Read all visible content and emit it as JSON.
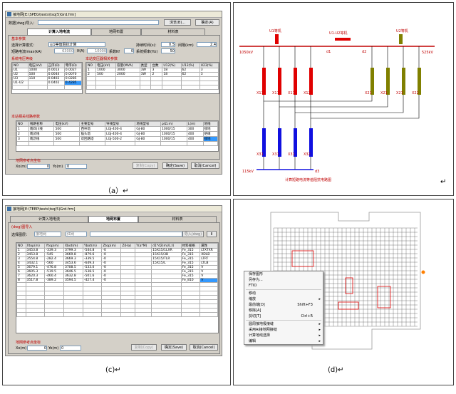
{
  "captions": {
    "a": "（a）↵",
    "b": "↵",
    "c": "(c)↵",
    "d": "(d)↵"
  },
  "panel_a": {
    "title": "接地网[E:\\SPEG\\tests\\tsq(5)Grd.frm]",
    "data_import_label": "数据(dwg)导入：",
    "browse_btn": "浏览(B)...",
    "ok_btn": "确定(A)",
    "tabs": [
      "计算入地电流",
      "地网布置",
      "材料表"
    ],
    "basic_params_title": "基本参数",
    "calc_mode_label": "选择计算模式：",
    "calc_mode_value": "◎1等值阻抗计算",
    "duration_label": "持续时间(s)：",
    "duration_value": "0.5",
    "gap_label": "间隔(km)",
    "gap_value": "2.4",
    "short_current_label": "短路电流Imax(kA)",
    "short_current_value": "63000",
    "if_label": "If(A)",
    "if_value": "10000",
    "coef_label": "系数Kf",
    "coef_value": "0",
    "freq_label": "系统频率(Hz)",
    "freq_value": "50",
    "sys_title": "系统电压等级",
    "sys_headers": [
      "NO",
      "电压(kV)",
      "正序(Ω)",
      "零序(Ω)"
    ],
    "sys_rows": [
      [
        "U1",
        "1000",
        "0.0013",
        "0.0027"
      ],
      [
        "U2",
        "500",
        "0.0044",
        "0.0070"
      ],
      [
        "U3",
        "110",
        "0.0402",
        "0.0285"
      ],
      [
        "U1-U2",
        "",
        "0.0402",
        "0.4285"
      ]
    ],
    "trans_title": "本站变压器相关参数",
    "trans_headers": [
      "NO",
      "电压(kV)",
      "容量(MVA)",
      "类型",
      "台数",
      "U12(%)",
      "U13(%)",
      "U23(%)"
    ],
    "trans_rows": [
      [
        "1",
        "1000",
        "3000",
        "3W",
        "3",
        "18",
        "62",
        "3"
      ],
      [
        "2",
        "500",
        "2000",
        "3W",
        "2",
        "18",
        "62",
        "3"
      ]
    ],
    "line_title": "本站相关线路参数",
    "line_headers": [
      "NO",
      "线路名称",
      "电压(kV)",
      "主要型号",
      "导线型号",
      "地线型号",
      "ρ(Ω.m)",
      "L(m)",
      "地线"
    ],
    "line_rows": [
      [
        "1",
        "南四川线",
        "500",
        "西杆塔",
        "LGJ-400-4",
        "GJ-80",
        "1000/15",
        "300",
        "接地"
      ],
      [
        "2",
        "南武线",
        "500",
        "猫头塔",
        "LGJ-400-4",
        "GJ-80",
        "1000/15",
        "400",
        "绝缘"
      ],
      [
        "3",
        "南沥线",
        "500",
        "双回路塔",
        "LGJ-500-2",
        "GJ-80",
        "1000/15",
        "400",
        "接地"
      ]
    ],
    "ref_title": "地网参考点坐标",
    "x_label": "Xo(m)",
    "x_value": "0",
    "y_label": "Yo(m)",
    "y_value": "0",
    "copy_btn": "复制(Copy)",
    "save_btn": "确定(Save)",
    "cancel_btn": "取消(Cancel)"
  },
  "panel_b": {
    "u1_label": "U1等机",
    "u12_label": "U1-U2等机",
    "u2_label": "U2等机",
    "left_bus": "1050kV",
    "right_bus": "525kV",
    "d1": "d1",
    "d2": "d2",
    "d3": "d3",
    "x11_labels": [
      "X11",
      "X11",
      "X11",
      "X12"
    ],
    "x21_labels": [
      "X21",
      "X21",
      "X21",
      "X22"
    ],
    "x31_labels": [
      "X31",
      "X31",
      "X31",
      "X32"
    ],
    "bottom_bus": "115kV",
    "caption": "计算短路电流等值阻抗电路图",
    "colors": {
      "bus": "#c00000",
      "x1": "#e00000",
      "x2": "#808000",
      "x3": "#1010e0",
      "wire": "#000000"
    }
  },
  "panel_c": {
    "title": "接地网[E:\\TEEP\\tests\\tsq(5)Grd.frm]",
    "tabs": [
      "计算入地电流",
      "地网布置",
      "材料表"
    ],
    "import_title": "(dwg)图导入",
    "layer_label": "选择图层：",
    "layer_value": "接地网",
    "color_value": "红网",
    "import_btn": "导入(dwg)",
    "small_btn": "II",
    "headers": [
      "NO",
      "Xtop(m)",
      "Ytop(m)",
      "Xbot(m)",
      "Ybot(m)",
      "Ztop(m)",
      "Z(Ha)",
      "Y(a*M)",
      "d1*d2(m)/L:4",
      "材料规格",
      "属性"
    ],
    "rows": [
      [
        "1",
        "3453.8",
        "-339.3",
        "3799.3",
        "-544.8",
        "-0",
        "",
        "",
        "15X15/1LXR",
        "Fe_315",
        "LTXTXR"
      ],
      [
        "2",
        "3453.8",
        "-545",
        "3669.8",
        "-879.6",
        "-0",
        "",
        "",
        "15X15/3B",
        "Fe_315",
        "XDLB"
      ],
      [
        "3",
        "3554.8",
        "-282.4",
        "3669.3",
        "-339.5",
        "-0",
        "",
        "",
        "15X15/TLR",
        "Fe_315",
        "LTRT"
      ],
      [
        "4",
        "3432.1",
        "-560",
        "3453.6",
        "-649.3",
        "-0",
        "",
        "",
        "15X15/L",
        "Fe_315",
        "LTLB"
      ],
      [
        "5",
        "3679.1",
        "-476.8",
        "3708.5",
        "-533.0",
        "-0",
        "",
        "",
        "",
        "Fe_315",
        "V"
      ],
      [
        "6",
        "3605.3",
        "-519.5",
        "3646.5",
        "-538.5",
        "-0",
        "",
        "",
        "",
        "Fe_315",
        "V"
      ],
      [
        "7",
        "3620.3",
        "-460.4",
        "3632.8",
        "-501.6",
        "-0",
        "",
        "",
        "",
        "Fe_315",
        "V"
      ],
      [
        "8",
        "3517.8",
        "-389.2",
        "3594.5",
        "-427.4",
        "-0",
        "",
        "",
        "",
        "Fe_810",
        "V"
      ]
    ],
    "ref_title": "地网参考点坐标",
    "x_label": "Xo(m)",
    "x_value": "0",
    "y_label": "Yo(m)",
    "y_value": "0",
    "copy_btn": "复制(Copy)",
    "save_btn": "确定(Save)",
    "cancel_btn": "取消(Cancel)"
  },
  "panel_d": {
    "menu": [
      {
        "label": "保存图形",
        "shortcut": "",
        "arrow": ""
      },
      {
        "label": "另存为...",
        "shortcut": "",
        "arrow": ""
      },
      {
        "label": "FTIO",
        "shortcut": "",
        "arrow": ""
      },
      {
        "sep": true
      },
      {
        "label": "移动",
        "shortcut": "",
        "arrow": ""
      },
      {
        "label": "缩放",
        "shortcut": "",
        "arrow": "▸"
      },
      {
        "label": "最前端[D]",
        "shortcut": "Shift+F3",
        "arrow": ""
      },
      {
        "label": "移除[A]",
        "shortcut": "",
        "arrow": ""
      },
      {
        "label": "剪切[T]",
        "shortcut": "Ctrl+R",
        "arrow": ""
      },
      {
        "sep": true
      },
      {
        "label": "圆周接地极接缝",
        "shortcut": "",
        "arrow": "▸"
      },
      {
        "label": "采用Ai接地网接缝",
        "shortcut": "",
        "arrow": "▸"
      },
      {
        "label": "计算地线选择",
        "shortcut": "",
        "arrow": "▸"
      },
      {
        "label": "编辑",
        "shortcut": "",
        "arrow": "▸"
      }
    ]
  }
}
